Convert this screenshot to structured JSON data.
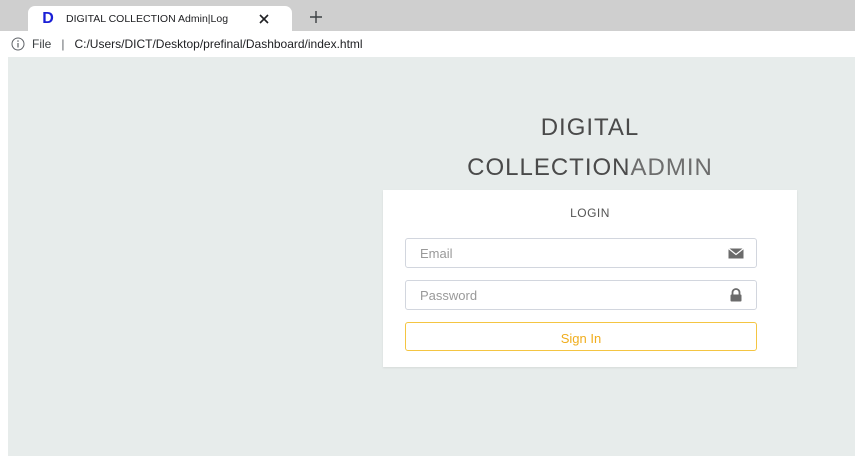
{
  "browser": {
    "tab": {
      "favicon_letter": "D",
      "title": "DIGITAL COLLECTION Admin|Log"
    },
    "address": {
      "scheme_label": "File",
      "separator": "|",
      "url": "C:/Users/DICT/Desktop/prefinal/Dashboard/index.html"
    }
  },
  "page": {
    "brand_line1": "DIGITAL",
    "brand_bold": "COLLECTION",
    "brand_light": "ADMIN",
    "login": {
      "title": "LOGIN",
      "email_placeholder": "Email",
      "password_placeholder": "Password",
      "signin_label": "Sign In"
    }
  },
  "colors": {
    "page_background": "#e7eceb",
    "favicon": "#1a1fd6",
    "signin_border": "#f4c542",
    "signin_text": "#f0ad1d"
  },
  "icons": {
    "email": "envelope-icon",
    "password": "lock-icon",
    "info": "info-icon",
    "close": "close-icon",
    "new_tab": "plus-icon"
  }
}
